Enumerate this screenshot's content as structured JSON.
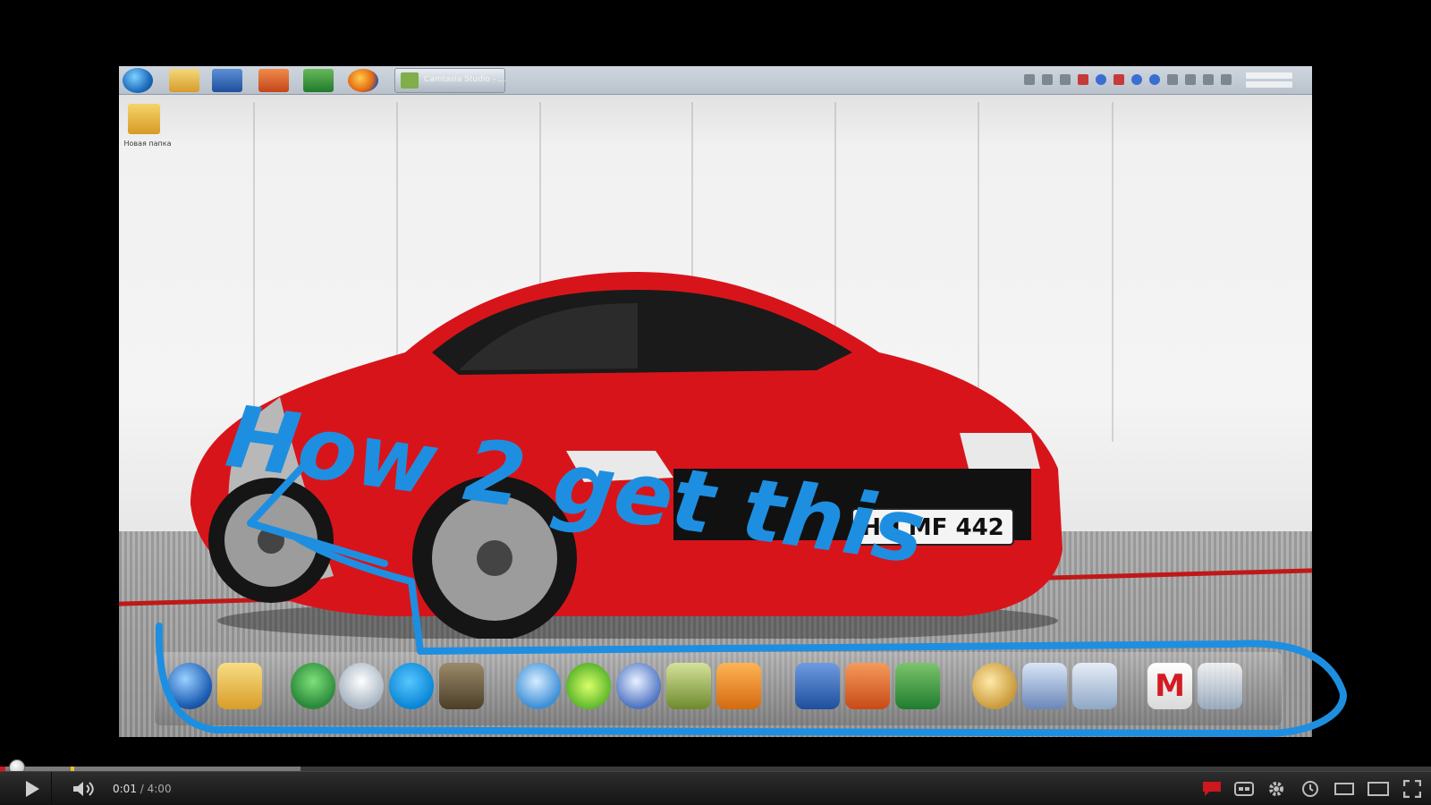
{
  "taskbar": {
    "active_window_label": "Camtasia Studio - ...",
    "pinned": [
      "windows-start-icon",
      "folder-icon",
      "word-icon",
      "powerpoint-icon",
      "excel-icon",
      "firefox-icon"
    ]
  },
  "desktop": {
    "folder_label": "Новая папка"
  },
  "annotation": {
    "text": "How 2 get this",
    "color": "#1e8fe0"
  },
  "car": {
    "plate": "HH MF 442",
    "color": "#d8141b"
  },
  "dock": {
    "icons": [
      "network-globe-icon",
      "folder-icon",
      "messenger-icon",
      "headset-icon",
      "skype-icon",
      "soldier-game-icon",
      "itunes-icon",
      "lime-icon",
      "media-player-icon",
      "photo-icon",
      "video-editor-icon",
      "word-icon",
      "powerpoint-icon",
      "excel-icon",
      "paint-icon",
      "printer-icon",
      "calculator-icon",
      "mcafee-icon",
      "recycle-bin-icon"
    ]
  },
  "player": {
    "current_time": "0:01",
    "separator": " / ",
    "duration": "4:00",
    "progress_fraction": 0.004,
    "buffered_fraction": 0.21,
    "accent": "#cc181e",
    "buttons": [
      "play-icon",
      "volume-icon",
      "annotations-icon",
      "captions-icon",
      "settings-icon",
      "watch-later-icon",
      "small-player-icon",
      "large-player-icon",
      "fullscreen-icon"
    ]
  }
}
